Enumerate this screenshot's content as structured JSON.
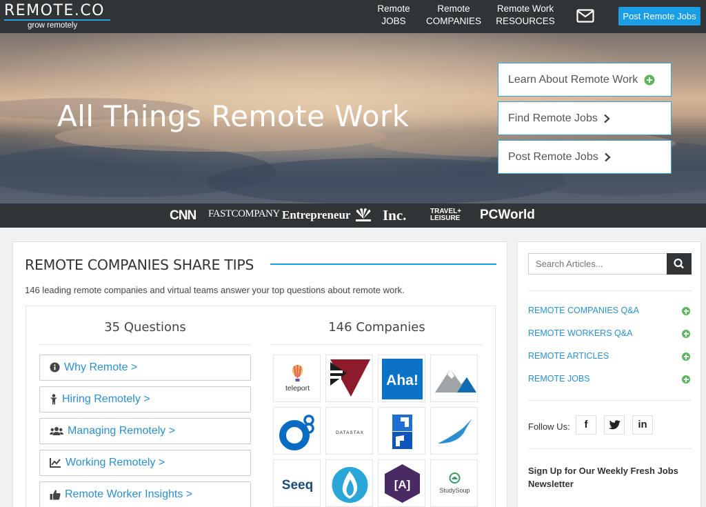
{
  "header": {
    "logo_text": "REMOTE.CO",
    "logo_tagline": "grow remotely",
    "nav": [
      {
        "line1": "Remote",
        "line2": "JOBS"
      },
      {
        "line1": "Remote",
        "line2": "COMPANIES"
      },
      {
        "line1": "Remote Work",
        "line2": "RESOURCES"
      }
    ],
    "mail_icon": "envelope-icon",
    "post_button": "Post Remote Jobs"
  },
  "hero": {
    "title": "All Things Remote Work",
    "buttons": [
      {
        "label": "Learn About Remote Work",
        "icon": "plus-circle-icon"
      },
      {
        "label": "Find Remote Jobs",
        "icon": "chevron-right-icon"
      },
      {
        "label": "Post Remote Jobs",
        "icon": "chevron-right-icon"
      }
    ]
  },
  "press": [
    "CNN",
    "FASTCOMPANY",
    "Entrepreneur",
    "NBC",
    "Inc.",
    "TRAVEL+ LEISURE",
    "PCWorld"
  ],
  "main": {
    "title": "REMOTE COMPANIES SHARE TIPS",
    "description": "146 leading remote companies and virtual teams answer your top questions about remote work.",
    "questions_heading": "35 Questions",
    "companies_heading": "146 Companies",
    "questions": [
      {
        "label": "Why Remote >",
        "icon": "info-circle-icon"
      },
      {
        "label": "Hiring Remotely >",
        "icon": "person-icon"
      },
      {
        "label": "Managing Remotely >",
        "icon": "users-icon"
      },
      {
        "label": "Working Remotely >",
        "icon": "line-chart-icon"
      },
      {
        "label": "Remote Worker Insights >",
        "icon": "thumbs-up-icon"
      }
    ],
    "companies": [
      "teleport",
      "",
      "Aha!",
      "",
      "",
      "DATASTAX",
      "",
      "",
      "Seeq",
      "",
      "[A]",
      "StudySoup"
    ]
  },
  "sidebar": {
    "search_placeholder": "Search Articles...",
    "links": [
      "REMOTE COMPANIES Q&A",
      "REMOTE WORKERS Q&A",
      "REMOTE ARTICLES",
      "REMOTE JOBS"
    ],
    "follow_label": "Follow Us:",
    "social": [
      {
        "label": "f",
        "icon": "facebook-icon"
      },
      {
        "label": "",
        "icon": "twitter-icon"
      },
      {
        "label": "in",
        "icon": "linkedin-icon"
      }
    ],
    "signup_text": "Sign Up for Our Weekly Fresh Jobs Newsletter"
  },
  "colors": {
    "accent": "#1a9ee5",
    "dark_bar": "#313436",
    "plus_green": "#5cb85c"
  }
}
